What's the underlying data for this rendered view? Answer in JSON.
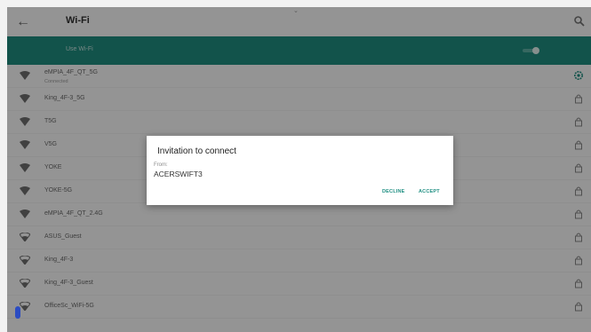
{
  "appbar": {
    "title": "Wi-Fi",
    "back_icon": "arrow-left-icon",
    "search_icon": "search-icon"
  },
  "pull_indicator": "⌄",
  "use_wifi": {
    "label": "Use Wi-Fi",
    "toggle_on": true,
    "color": "#1f8f82"
  },
  "networks": [
    {
      "name": "eMPIA_4F_QT_5G",
      "status": "Connected",
      "icon": "wifi-full-icon",
      "right_icon": "gear-icon"
    },
    {
      "name": "King_4F-3_5G",
      "status": "",
      "icon": "wifi-full-icon",
      "right_icon": "lock-icon"
    },
    {
      "name": "T5G",
      "status": "",
      "icon": "wifi-full-icon",
      "right_icon": "lock-icon"
    },
    {
      "name": "V5G",
      "status": "",
      "icon": "wifi-full-icon",
      "right_icon": "lock-icon"
    },
    {
      "name": "YOKE",
      "status": "",
      "icon": "wifi-full-icon",
      "right_icon": "lock-icon"
    },
    {
      "name": "YOKE-5G",
      "status": "",
      "icon": "wifi-full-icon",
      "right_icon": "lock-icon"
    },
    {
      "name": "eMPIA_4F_QT_2.4G",
      "status": "",
      "icon": "wifi-full-icon",
      "right_icon": "lock-icon"
    },
    {
      "name": "ASUS_Guest",
      "status": "",
      "icon": "wifi-weak-icon",
      "right_icon": "lock-icon"
    },
    {
      "name": "King_4F-3",
      "status": "",
      "icon": "wifi-weak-icon",
      "right_icon": "lock-icon"
    },
    {
      "name": "King_4F-3_Guest",
      "status": "",
      "icon": "wifi-weak-icon",
      "right_icon": "lock-icon"
    },
    {
      "name": "OfficeSc_WiFi-5G",
      "status": "",
      "icon": "wifi-weak-icon",
      "right_icon": "lock-icon"
    }
  ],
  "dialog": {
    "title": "Invitation to connect",
    "from_label": "From:",
    "device": "ACERSWIFT3",
    "decline_label": "DECLINE",
    "accept_label": "ACCEPT"
  }
}
